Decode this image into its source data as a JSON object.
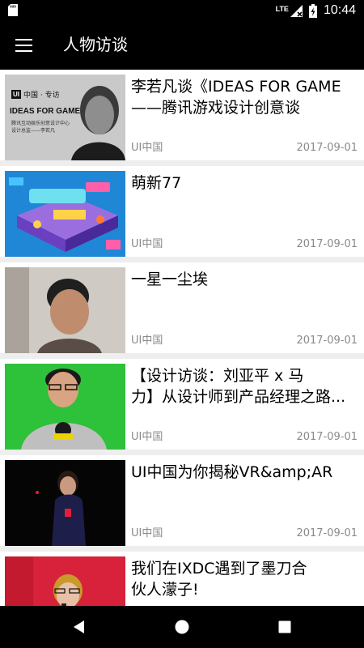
{
  "status": {
    "network": "LTE",
    "time": "10:44",
    "icons": [
      "sd-card-icon",
      "signal-icon",
      "battery-icon"
    ]
  },
  "header": {
    "title": "人物访谈",
    "menu_icon": "hamburger-menu-icon"
  },
  "articles": [
    {
      "title_lines": [
        "李若凡谈《IDEAS FOR GAME",
        "——腾讯游戏设计创意谈"
      ],
      "source": "UI中国",
      "date": "2017-09-01",
      "thumb_text": {
        "brand": "中国 · 专访",
        "headline": "IDEAS FOR GAME",
        "sub1": "腾讯互动娱乐创意设计中心",
        "sub2": "设计总监——李若凡"
      }
    },
    {
      "title_lines": [
        "萌新77"
      ],
      "source": "UI中国",
      "date": "2017-09-01"
    },
    {
      "title_lines": [
        "一星一尘埃"
      ],
      "source": "UI中国",
      "date": "2017-09-01"
    },
    {
      "title_lines": [
        "【设计访谈：刘亚平 x 马",
        "力】从设计师到产品经理之路..."
      ],
      "source": "UI中国",
      "date": "2017-09-01"
    },
    {
      "title_lines": [
        "UI中国为你揭秘VR&amp;AR"
      ],
      "source": "UI中国",
      "date": "2017-09-01"
    },
    {
      "title_lines": [
        "我们在IXDC遇到了墨刀合",
        "伙人濛子!"
      ],
      "source": "",
      "date": ""
    }
  ],
  "colors": {
    "bar_background": "#000000",
    "card_background": "#ffffff",
    "list_background": "#eeeeee",
    "meta_text": "#8a8a8a"
  },
  "navigation": {
    "back_icon": "back-triangle-icon",
    "home_icon": "home-circle-icon",
    "recents_icon": "recents-square-icon"
  }
}
